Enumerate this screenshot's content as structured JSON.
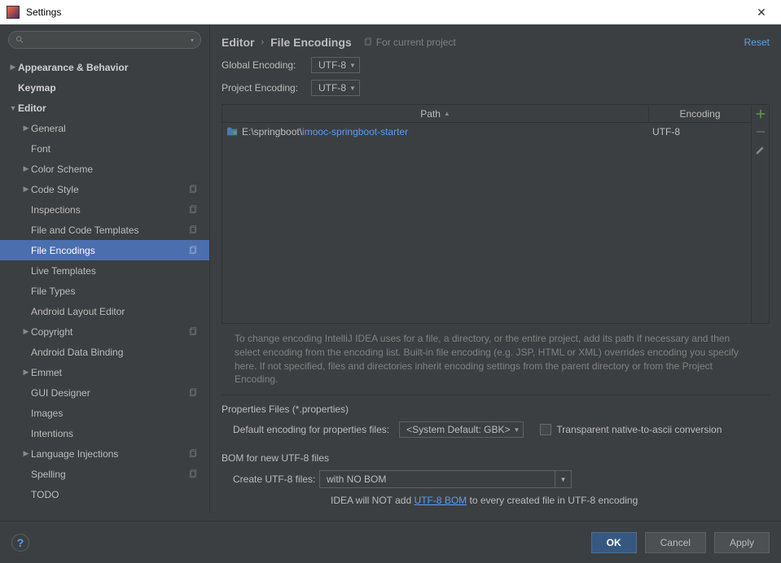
{
  "window": {
    "title": "Settings"
  },
  "breadcrumb": {
    "a": "Editor",
    "b": "File Encodings",
    "proj": "For current project",
    "reset": "Reset"
  },
  "global": {
    "label": "Global Encoding:",
    "value": "UTF-8"
  },
  "project": {
    "label": "Project Encoding:",
    "value": "UTF-8"
  },
  "table": {
    "path_header": "Path",
    "enc_header": "Encoding",
    "row_prefix": "E:\\springboot\\",
    "row_suffix": "imooc-springboot-starter",
    "row_enc": "UTF-8"
  },
  "hint": "To change encoding IntelliJ IDEA uses for a file, a directory, or the entire project, add its path if necessary and then select encoding from the encoding list. Built-in file encoding (e.g. JSP, HTML or XML) overrides encoding you specify here. If not specified, files and directories inherit encoding settings from the parent directory or from the Project Encoding.",
  "props": {
    "section": "Properties Files (*.properties)",
    "label": "Default encoding for properties files:",
    "value": "<System Default: GBK>",
    "checkbox": "Transparent native-to-ascii conversion"
  },
  "bom": {
    "section": "BOM for new UTF-8 files",
    "label": "Create UTF-8 files:",
    "value": "with NO BOM",
    "note_a": "IDEA will NOT add ",
    "note_link": "UTF-8 BOM",
    "note_b": " to every created file in UTF-8 encoding"
  },
  "tree": [
    {
      "label": "Appearance & Behavior",
      "indent": 0,
      "caret": "▶",
      "bold": true
    },
    {
      "label": "Keymap",
      "indent": 0,
      "caret": "",
      "bold": true
    },
    {
      "label": "Editor",
      "indent": 0,
      "caret": "▼",
      "bold": true
    },
    {
      "label": "General",
      "indent": 1,
      "caret": "▶"
    },
    {
      "label": "Font",
      "indent": 1,
      "caret": ""
    },
    {
      "label": "Color Scheme",
      "indent": 1,
      "caret": "▶"
    },
    {
      "label": "Code Style",
      "indent": 1,
      "caret": "▶",
      "copy": true
    },
    {
      "label": "Inspections",
      "indent": 1,
      "caret": "",
      "copy": true
    },
    {
      "label": "File and Code Templates",
      "indent": 1,
      "caret": "",
      "copy": true
    },
    {
      "label": "File Encodings",
      "indent": 1,
      "caret": "",
      "copy": true,
      "selected": true
    },
    {
      "label": "Live Templates",
      "indent": 1,
      "caret": ""
    },
    {
      "label": "File Types",
      "indent": 1,
      "caret": ""
    },
    {
      "label": "Android Layout Editor",
      "indent": 1,
      "caret": ""
    },
    {
      "label": "Copyright",
      "indent": 1,
      "caret": "▶",
      "copy": true
    },
    {
      "label": "Android Data Binding",
      "indent": 1,
      "caret": ""
    },
    {
      "label": "Emmet",
      "indent": 1,
      "caret": "▶"
    },
    {
      "label": "GUI Designer",
      "indent": 1,
      "caret": "",
      "copy": true
    },
    {
      "label": "Images",
      "indent": 1,
      "caret": ""
    },
    {
      "label": "Intentions",
      "indent": 1,
      "caret": ""
    },
    {
      "label": "Language Injections",
      "indent": 1,
      "caret": "▶",
      "copy": true
    },
    {
      "label": "Spelling",
      "indent": 1,
      "caret": "",
      "copy": true
    },
    {
      "label": "TODO",
      "indent": 1,
      "caret": ""
    }
  ],
  "footer": {
    "ok": "OK",
    "cancel": "Cancel",
    "apply": "Apply"
  }
}
